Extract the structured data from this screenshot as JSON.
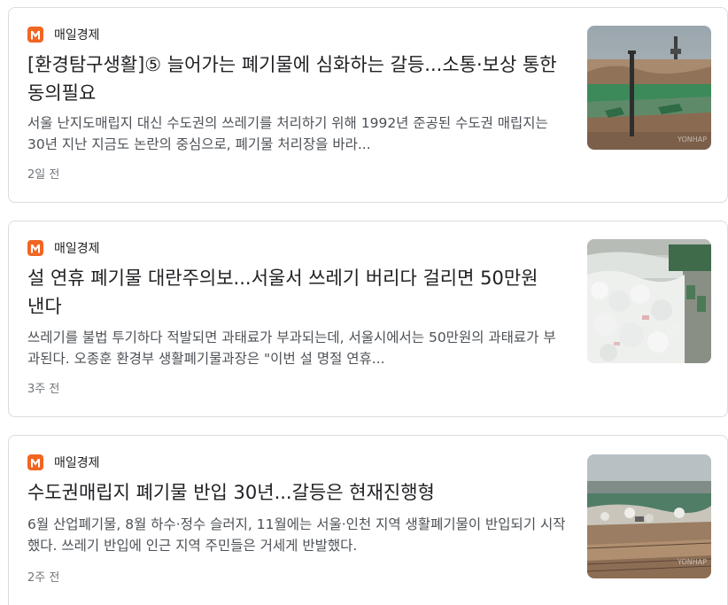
{
  "articles": [
    {
      "source": "매일경제",
      "title": "[환경탐구생활]⑤ 늘어가는 폐기물에 심화하는 갈등...소통·보상 통한 동의필요",
      "snippet": "서울 난지도매립지 대신 수도권의 쓰레기를 처리하기 위해 1992년 준공된 수도권 매립지는 30년 지난 지금도 논란의 중심으로, 폐기물 처리장을 바라...",
      "time": "2일 전",
      "thumbnail_watermark": "YONHAP"
    },
    {
      "source": "매일경제",
      "title": "설 연휴 폐기물 대란주의보...서울서 쓰레기 버리다 걸리면 50만원 낸다",
      "snippet": "쓰레기를 불법 투기하다 적발되면 과태료가 부과되는데, 서울시에서는 50만원의 과태료가 부과된다. 오종훈 환경부 생활폐기물과장은 \"이번 설 명절 연휴...",
      "time": "3주 전"
    },
    {
      "source": "매일경제",
      "title": "수도권매립지 폐기물 반입 30년...갈등은 현재진행형",
      "snippet": "6월 산업폐기물, 8월 하수·정수 슬러지, 11월에는 서울·인천 지역 생활폐기물이 반입되기 시작했다. 쓰레기 반입에 인근 지역 주민들은 거세게 반발했다.",
      "time": "2주 전",
      "thumbnail_watermark": "YONHAP"
    }
  ],
  "colors": {
    "logo": "#f26522",
    "title": "#202124",
    "snippet": "#4d5156",
    "time": "#70757a",
    "border": "#dadce0"
  }
}
